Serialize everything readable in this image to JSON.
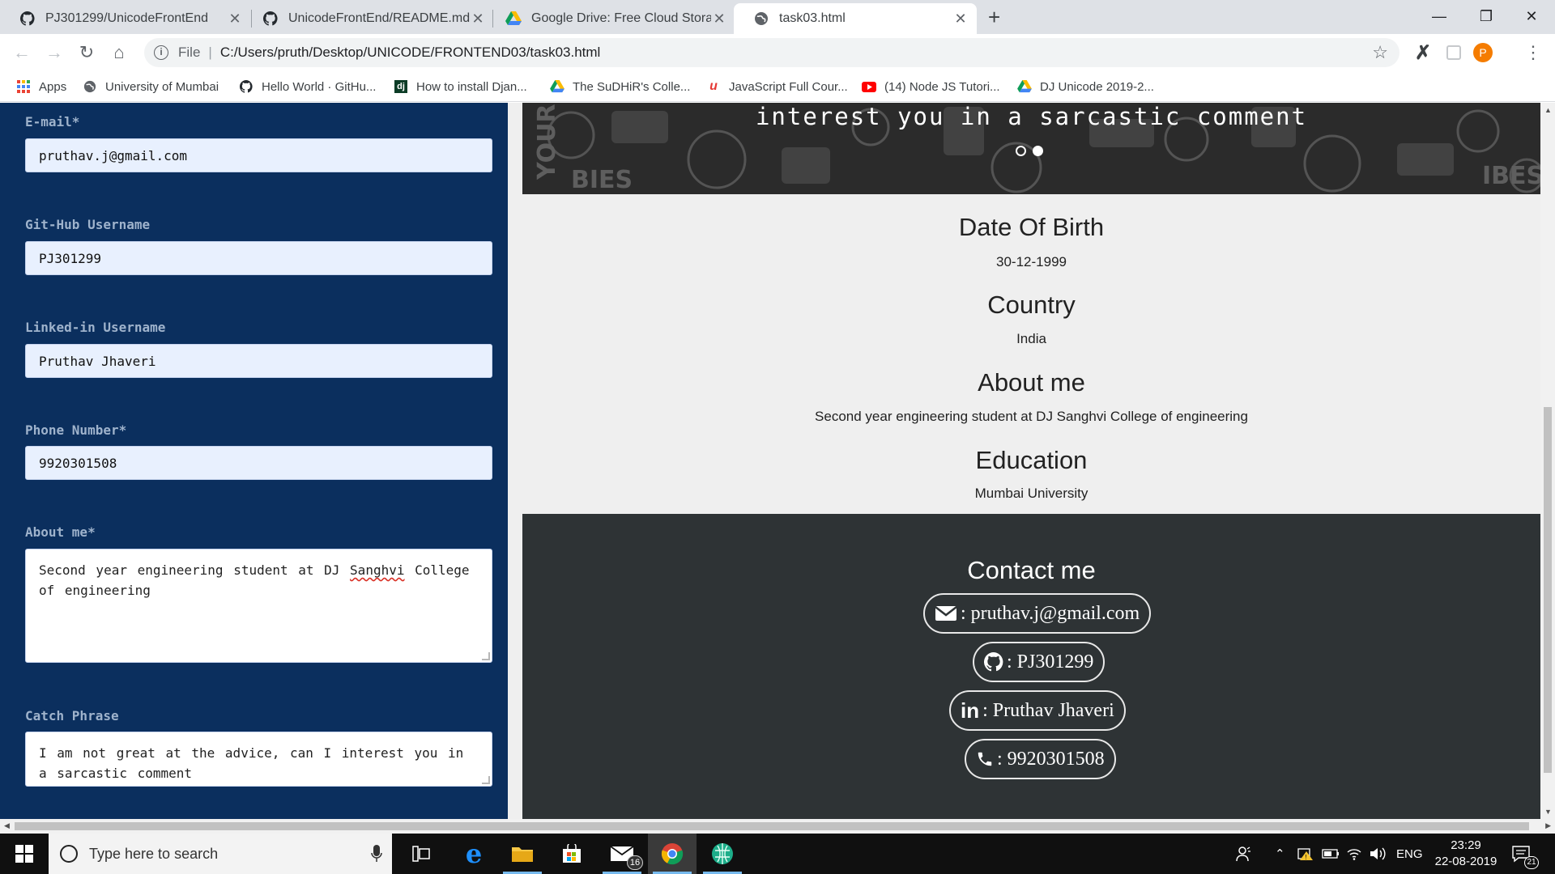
{
  "browser": {
    "tabs": [
      {
        "title": "PJ301299/UnicodeFrontEnd",
        "icon": "github-icon",
        "active": false
      },
      {
        "title": "UnicodeFrontEnd/README.md at",
        "icon": "github-icon",
        "active": false
      },
      {
        "title": "Google Drive: Free Cloud Storage",
        "icon": "google-drive-icon",
        "active": false
      },
      {
        "title": "task03.html",
        "icon": "globe-icon",
        "active": true
      }
    ],
    "url_scheme": "File",
    "url": "C:/Users/pruth/Desktop/UNICODE/FRONTEND03/task03.html",
    "profile_initial": "P",
    "bookmarks": [
      {
        "label": "Apps",
        "icon": "apps-grid-icon"
      },
      {
        "label": "University of Mumbai",
        "icon": "globe-icon"
      },
      {
        "label": "Hello World · GitHu...",
        "icon": "github-icon"
      },
      {
        "label": "How to install Djan...",
        "icon": "dj-icon"
      },
      {
        "label": "The SuDHiR's Colle...",
        "icon": "google-drive-icon"
      },
      {
        "label": "JavaScript Full Cour...",
        "icon": "udemy-icon"
      },
      {
        "label": "(14) Node JS Tutori...",
        "icon": "youtube-icon"
      },
      {
        "label": "DJ Unicode 2019-2...",
        "icon": "google-drive-icon"
      }
    ]
  },
  "form": {
    "email_label": "E-mail*",
    "email_value": "pruthav.j@gmail.com",
    "github_label": "Git-Hub Username",
    "github_value": "PJ301299",
    "linkedin_label": "Linked-in Username",
    "linkedin_value": "Pruthav Jhaveri",
    "phone_label": "Phone Number*",
    "phone_value": "9920301508",
    "about_label": "About me*",
    "about_value_pre": "Second year engineering student at DJ ",
    "about_value_misspelled": "Sanghvi",
    "about_value_post": " College of engineering",
    "catch_label": "Catch Phrase",
    "catch_value": "I am not great at the advice, can I interest you in a sarcastic comment"
  },
  "hero": {
    "text": "interest you in a sarcastic comment",
    "active_slide": 2,
    "slide_count": 2
  },
  "profile": {
    "dob_heading": "Date Of Birth",
    "dob_value": "30-12-1999",
    "country_heading": "Country",
    "country_value": "India",
    "about_heading": "About me",
    "about_value": "Second year engineering student at DJ Sanghvi College of engineering",
    "education_heading": "Education",
    "education_value": "Mumbai University"
  },
  "contact": {
    "title": "Contact me",
    "email": ": pruthav.j@gmail.com",
    "github": ": PJ301299",
    "linkedin": ": Pruthav Jhaveri",
    "phone": ": 9920301508"
  },
  "taskbar": {
    "search_placeholder": "Type here to search",
    "mail_badge": "16",
    "language": "ENG",
    "time": "23:29",
    "date": "22-08-2019",
    "notification_count": "21"
  },
  "colors": {
    "left_panel": "#0b2f5e",
    "contact_bg": "#2e3335",
    "page_bg": "#efefef"
  }
}
